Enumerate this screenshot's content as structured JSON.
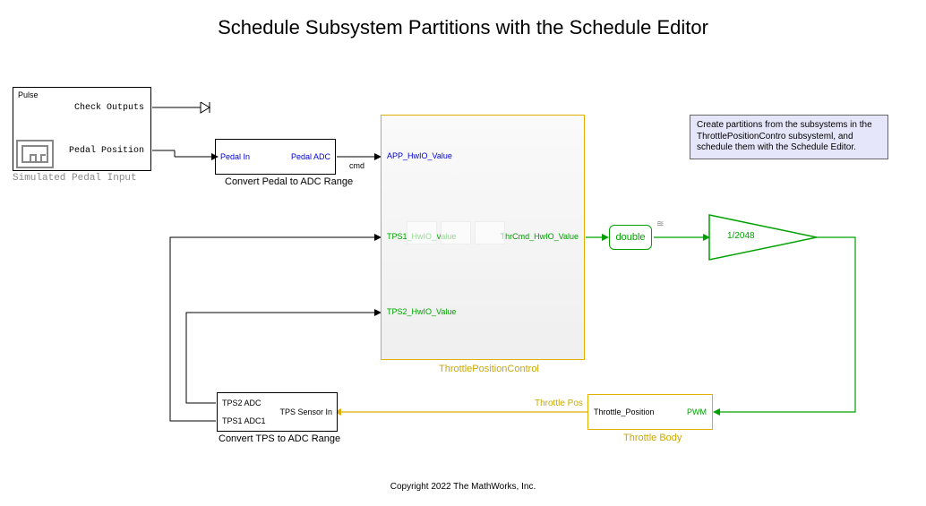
{
  "title": "Schedule Subsystem Partitions with the Schedule Editor",
  "pedal_block": {
    "pulse": "Pulse",
    "check_outputs": "Check Outputs",
    "pedal_position": "Pedal Position",
    "caption": "Simulated Pedal Input"
  },
  "convert_pedal": {
    "in": "Pedal In",
    "out": "Pedal ADC",
    "caption": "Convert Pedal to ADC Range",
    "cmd": "cmd"
  },
  "throttle_control": {
    "app": "APP_HwIO_Value",
    "tps1": "TPS1_HwIO_Value",
    "tps2": "TPS2_HwIO_Value",
    "out": "ThrCmd_HwIO_Value",
    "caption": "ThrottlePositionControl"
  },
  "double_cast": "double",
  "gain": "1/2048",
  "throttle_body": {
    "in": "PWM",
    "out": "Throttle_Position",
    "out_signal": "Throttle Pos",
    "caption": "Throttle Body"
  },
  "convert_tps": {
    "in": "TPS Sensor In",
    "out1": "TPS2 ADC",
    "out2": "TPS1 ADC1",
    "caption": "Convert TPS to ADC Range"
  },
  "note": "Create partitions from the subsystems in the ThrottlePositionContro subsysteml, and schedule them with the Schedule Editor.",
  "copyright": "Copyright 2022 The MathWorks, Inc."
}
